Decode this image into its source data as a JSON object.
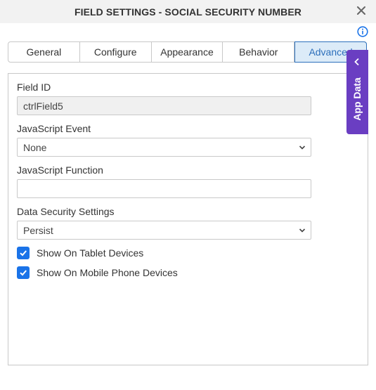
{
  "dialog": {
    "title": "FIELD SETTINGS - SOCIAL SECURITY NUMBER",
    "close_icon": "close-icon",
    "info_icon": "info-icon"
  },
  "tabs": [
    {
      "label": "General",
      "active": false
    },
    {
      "label": "Configure",
      "active": false
    },
    {
      "label": "Appearance",
      "active": false
    },
    {
      "label": "Behavior",
      "active": false
    },
    {
      "label": "Advanced",
      "active": true
    }
  ],
  "form": {
    "field_id_label": "Field ID",
    "field_id_value": "ctrlField5",
    "js_event_label": "JavaScript Event",
    "js_event_value": "None",
    "js_function_label": "JavaScript Function",
    "js_function_value": "",
    "data_security_label": "Data Security Settings",
    "data_security_value": "Persist",
    "show_tablet_label": "Show On Tablet Devices",
    "show_tablet_checked": true,
    "show_mobile_label": "Show On Mobile Phone Devices",
    "show_mobile_checked": true
  },
  "app_data": {
    "label": "App Data",
    "icon": "chevron-left-icon"
  },
  "colors": {
    "accent": "#2c6fbb",
    "checkbox": "#1a73e8",
    "app_data_bg": "#6a3ec2",
    "active_tab_bg": "#dcebf8"
  }
}
